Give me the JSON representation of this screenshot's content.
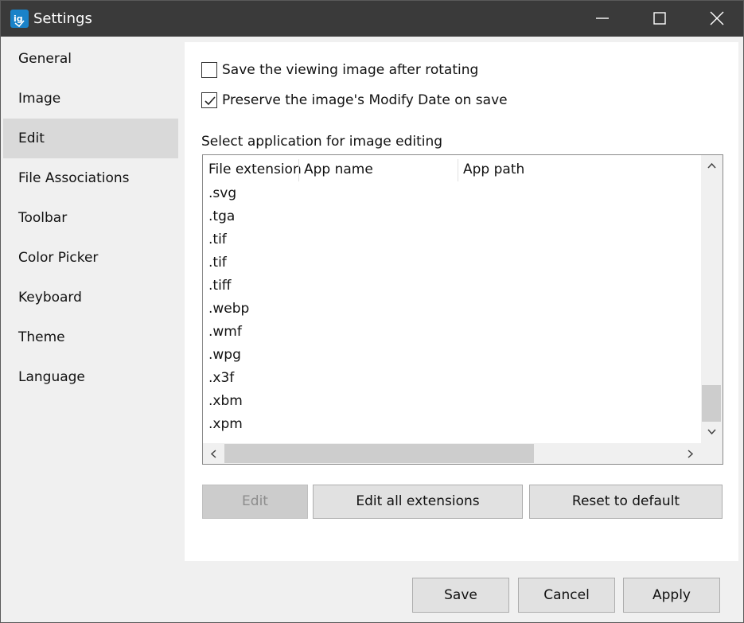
{
  "window": {
    "title": "Settings",
    "controls": {
      "minimize": "minimize-icon",
      "maximize": "maximize-icon",
      "close": "close-icon"
    }
  },
  "sidebar": {
    "items": [
      {
        "label": "General"
      },
      {
        "label": "Image"
      },
      {
        "label": "Edit",
        "active": true
      },
      {
        "label": "File Associations"
      },
      {
        "label": "Toolbar"
      },
      {
        "label": "Color Picker"
      },
      {
        "label": "Keyboard"
      },
      {
        "label": "Theme"
      },
      {
        "label": "Language"
      }
    ]
  },
  "edit": {
    "save_after_rotating": {
      "label": "Save the viewing image after rotating",
      "checked": false
    },
    "preserve_modify_date": {
      "label": "Preserve the image's Modify Date on save",
      "checked": true
    },
    "section_label": "Select application for image editing",
    "table": {
      "columns": [
        "File extension",
        "App name",
        "App path"
      ],
      "rows": [
        ".svg",
        ".tga",
        ".tif",
        ".tif",
        ".tiff",
        ".webp",
        ".wmf",
        ".wpg",
        ".x3f",
        ".xbm",
        ".xpm"
      ]
    },
    "buttons": {
      "edit": "Edit",
      "edit_all": "Edit all extensions",
      "reset": "Reset to default"
    }
  },
  "footer": {
    "save": "Save",
    "cancel": "Cancel",
    "apply": "Apply"
  },
  "colors": {
    "titlebar": "#3a3a3a",
    "sidebar_active": "#d9d9d9",
    "app_icon": "#1a82c8"
  }
}
